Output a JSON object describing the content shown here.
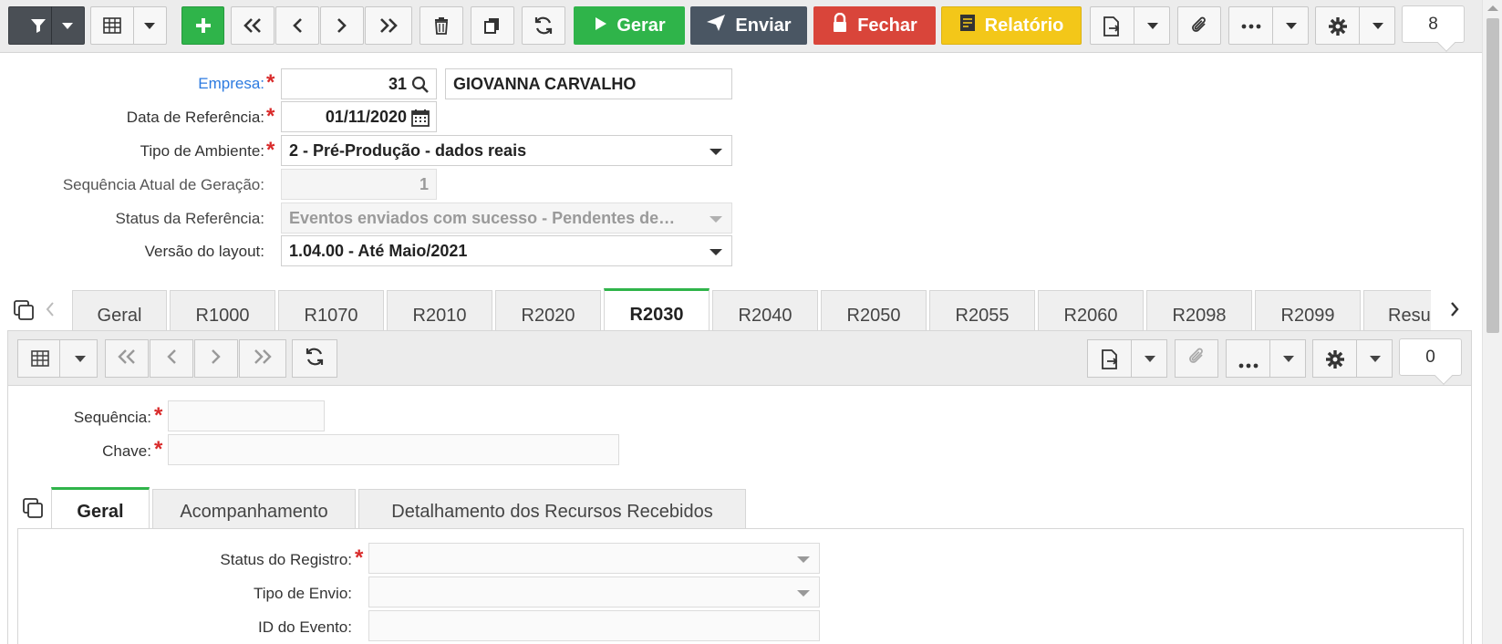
{
  "toolbar": {
    "gerar": "Gerar",
    "enviar": "Enviar",
    "fechar": "Fechar",
    "relatorio": "Relatório",
    "count": "8",
    "colors": {
      "dark": "#4a4f55",
      "green": "#2fb44a",
      "blue": "#4a5663",
      "red": "#d9453a",
      "yellow": "#f3c719"
    }
  },
  "form": {
    "empresa_label": "Empresa:",
    "empresa_code": "31",
    "empresa_name": "GIOVANNA CARVALHO",
    "data_label": "Data de Referência:",
    "data_value": "01/11/2020",
    "tipo_label": "Tipo de Ambiente:",
    "tipo_value": "2 - Pré-Produção - dados reais",
    "seq_label": "Sequência Atual de Geração:",
    "seq_value": "1",
    "status_label": "Status da Referência:",
    "status_value": "Eventos enviados com sucesso - Pendentes de…",
    "versao_label": "Versão do layout:",
    "versao_value": "1.04.00 - Até Maio/2021"
  },
  "tabs": [
    "Geral",
    "R1000",
    "R1070",
    "R2010",
    "R2020",
    "R2030",
    "R2040",
    "R2050",
    "R2055",
    "R2060",
    "R2098",
    "R2099",
    "Resu"
  ],
  "active_tab": "R2030",
  "subform": {
    "count": "0",
    "sequencia_label": "Sequência:",
    "chave_label": "Chave:"
  },
  "inner_tabs": [
    "Geral",
    "Acompanhamento",
    "Detalhamento dos Recursos Recebidos"
  ],
  "inner_form": {
    "status_label": "Status do Registro:",
    "tipo_envio_label": "Tipo de Envio:",
    "id_evento_label": "ID do Evento:"
  }
}
